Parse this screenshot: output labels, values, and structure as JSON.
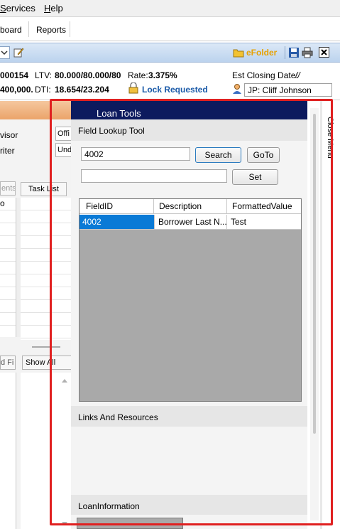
{
  "menubar": {
    "items": [
      {
        "label": "Services",
        "underline": "S",
        "rest": "ervices"
      },
      {
        "label": "Help",
        "underline": "H",
        "rest": "elp"
      }
    ]
  },
  "tabs": [
    "board",
    "Reports"
  ],
  "toolbar": {
    "efolder_label": "eFolder",
    "icons": [
      "edit-icon",
      "folder-icon",
      "save-icon",
      "print-icon",
      "close-icon"
    ]
  },
  "summary": {
    "loan_number": "000154",
    "loan_amount": "400,000.",
    "ltv_label": "LTV:",
    "ltv_value": "80.000/80.000/80",
    "dti_label": "DTI:",
    "dti_value": "18.654/23.204",
    "rate_label": "Rate:",
    "rate_value": "3.375%",
    "lock_status": "Lock Requested",
    "closing_label": "Est Closing Date:",
    "closing_value": "//",
    "officer_value": "JP: Cliff Johnson"
  },
  "left_panel": {
    "labels": [
      "visor",
      "riter"
    ],
    "fields": [
      "Offi",
      "Und"
    ],
    "tab_left": "ents",
    "tab_task": "Task List",
    "row_first": "o",
    "btn_left": "d Fi",
    "btn_show": "Show All"
  },
  "loan_tools": {
    "title": "Loan Tools",
    "field_lookup_title": "Field Lookup Tool",
    "search_value": "4002",
    "search_button": "Search",
    "goto_button": "GoTo",
    "set_value": "",
    "set_button": "Set",
    "columns": [
      "FieldID",
      "Description",
      "FormattedValue"
    ],
    "rows": [
      {
        "field_id": "4002",
        "description": "Borrower Last N...",
        "formatted_value": "Test"
      }
    ],
    "links_title": "Links And Resources",
    "loan_info_title": "LoanInformation"
  },
  "close_menu_label": "Close Menu",
  "colors": {
    "highlight": "#e02020",
    "header_navy": "#0c1a5e",
    "selected_cell": "#0a7ad6",
    "lock_blue": "#1a5aa8"
  }
}
